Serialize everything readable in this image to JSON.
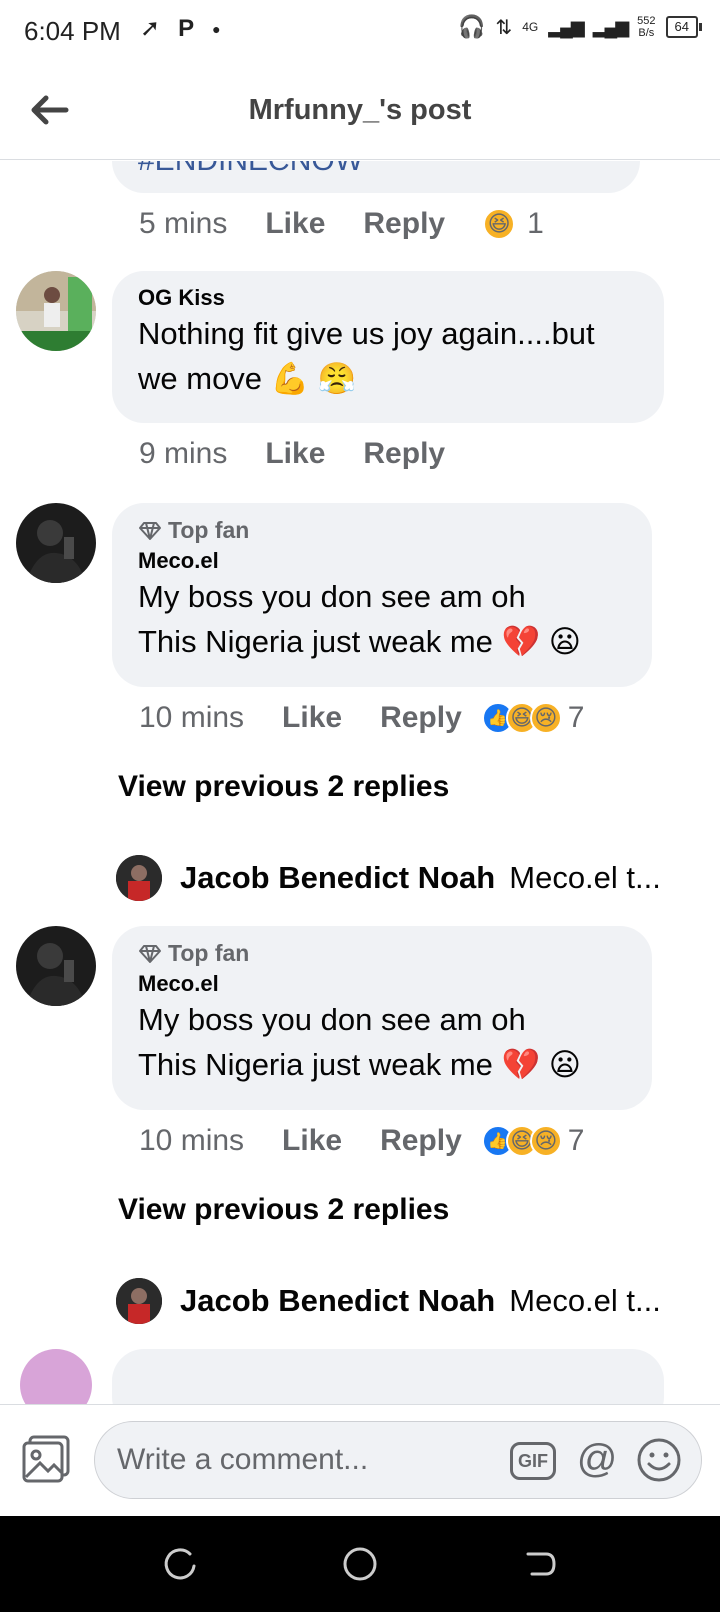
{
  "status_bar": {
    "time": "6:04 PM",
    "net_speed_value": "552",
    "net_speed_unit": "B/s",
    "network": "4G",
    "battery": "64"
  },
  "header": {
    "title": "Mrfunny_'s post"
  },
  "comments": [
    {
      "partial_text": "#ENDINECNOW",
      "time": "5 mins",
      "like": "Like",
      "reply": "Reply",
      "reaction_count": "1"
    },
    {
      "name": "OG Kiss",
      "text_line1": "Nothing fit give us joy again....but",
      "text_line2": "we move 💪 😤",
      "time": "9 mins",
      "like": "Like",
      "reply": "Reply"
    },
    {
      "badge": "Top fan",
      "name": "Meco.el",
      "text_line1": "My boss you don see am oh",
      "text_line2": "This Nigeria just weak me 💔 😦",
      "time": "10 mins",
      "like": "Like",
      "reply": "Reply",
      "reaction_count": "7",
      "view_previous": "View previous 2 replies",
      "latest_reply": {
        "name": "Jacob Benedict Noah",
        "text": "Meco.el t..."
      }
    },
    {
      "badge": "Top fan",
      "name": "Meco.el",
      "text_line1": "My boss you don see am oh",
      "text_line2": "This Nigeria just weak me 💔 😦",
      "time": "10 mins",
      "like": "Like",
      "reply": "Reply",
      "reaction_count": "7",
      "view_previous": "View previous 2 replies",
      "latest_reply": {
        "name": "Jacob Benedict Noah",
        "text": "Meco.el t..."
      }
    }
  ],
  "composer": {
    "placeholder": "Write a comment...",
    "gif_label": "GIF",
    "mention_symbol": "@"
  },
  "colors": {
    "accent_blue": "#1877f2",
    "bubble_bg": "#f0f2f5",
    "secondary_text": "#65676b"
  }
}
